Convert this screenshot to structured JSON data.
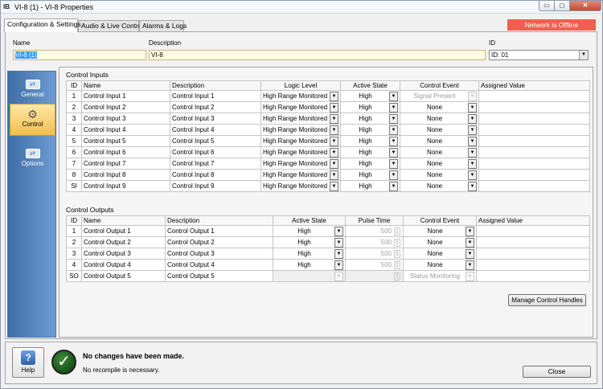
{
  "window": {
    "app_icon_text": "IB",
    "title": "VI-8 (1) - VI-8 Properties",
    "controls": {
      "minimize": "▭",
      "maximize": "◻",
      "close": "✕"
    }
  },
  "tabs": [
    {
      "label": "Configuration & Settings",
      "active": true
    },
    {
      "label": "Audio & Live Control",
      "active": false
    },
    {
      "label": "Alarms & Logs",
      "active": false
    }
  ],
  "status_badge": {
    "label": "Network is Offline",
    "color": "#f06050"
  },
  "header": {
    "name_label": "Name",
    "name_value": "VI-8 (1)",
    "description_label": "Description",
    "description_value": "VI-8",
    "id_label": "ID",
    "id_value": "ID: 01"
  },
  "sidebar": {
    "items": [
      {
        "label": "General",
        "icon": "network-icon",
        "active": false
      },
      {
        "label": "Control",
        "icon": "gear-icon",
        "active": true
      },
      {
        "label": "Options",
        "icon": "network-icon",
        "active": false
      }
    ]
  },
  "control_inputs": {
    "title": "Control Inputs",
    "columns": {
      "id": "ID",
      "name": "Name",
      "description": "Description",
      "logic_level": "Logic Level",
      "active_state": "Active State",
      "control_event": "Control Event",
      "assigned_value": "Assigned Value"
    },
    "rows": [
      {
        "id": "1",
        "name": "Control Input 1",
        "description": "Control Input 1",
        "logic_level": "High Range Monitored",
        "active_state": "High",
        "control_event": "Signal Present",
        "assigned_value": ""
      },
      {
        "id": "2",
        "name": "Control Input 2",
        "description": "Control Input 2",
        "logic_level": "High Range Monitored",
        "active_state": "High",
        "control_event": "None",
        "assigned_value": ""
      },
      {
        "id": "3",
        "name": "Control Input 3",
        "description": "Control Input 3",
        "logic_level": "High Range Monitored",
        "active_state": "High",
        "control_event": "None",
        "assigned_value": ""
      },
      {
        "id": "4",
        "name": "Control Input 4",
        "description": "Control Input 4",
        "logic_level": "High Range Monitored",
        "active_state": "High",
        "control_event": "None",
        "assigned_value": ""
      },
      {
        "id": "5",
        "name": "Control Input 5",
        "description": "Control Input 5",
        "logic_level": "High Range Monitored",
        "active_state": "High",
        "control_event": "None",
        "assigned_value": ""
      },
      {
        "id": "6",
        "name": "Control Input 6",
        "description": "Control Input 6",
        "logic_level": "High Range Monitored",
        "active_state": "High",
        "control_event": "None",
        "assigned_value": ""
      },
      {
        "id": "7",
        "name": "Control Input 7",
        "description": "Control Input 7",
        "logic_level": "High Range Monitored",
        "active_state": "High",
        "control_event": "None",
        "assigned_value": ""
      },
      {
        "id": "8",
        "name": "Control Input 8",
        "description": "Control Input 8",
        "logic_level": "High Range Monitored",
        "active_state": "High",
        "control_event": "None",
        "assigned_value": ""
      },
      {
        "id": "SI",
        "name": "Control Input 9",
        "description": "Control Input 9",
        "logic_level": "High Range Monitored",
        "active_state": "High",
        "control_event": "None",
        "assigned_value": ""
      }
    ]
  },
  "control_outputs": {
    "title": "Control Outputs",
    "columns": {
      "id": "ID",
      "name": "Name",
      "description": "Description",
      "active_state": "Active State",
      "pulse_time": "Pulse Time",
      "control_event": "Control Event",
      "assigned_value": "Assigned Value"
    },
    "rows": [
      {
        "id": "1",
        "name": "Control Output 1",
        "description": "Control Output 1",
        "active_state": "High",
        "pulse_time": "500",
        "control_event": "None",
        "assigned_value": ""
      },
      {
        "id": "2",
        "name": "Control Output 2",
        "description": "Control Output 2",
        "active_state": "High",
        "pulse_time": "500",
        "control_event": "None",
        "assigned_value": ""
      },
      {
        "id": "3",
        "name": "Control Output 3",
        "description": "Control Output 3",
        "active_state": "High",
        "pulse_time": "500",
        "control_event": "None",
        "assigned_value": ""
      },
      {
        "id": "4",
        "name": "Control Output 4",
        "description": "Control Output 4",
        "active_state": "High",
        "pulse_time": "500",
        "control_event": "None",
        "assigned_value": ""
      },
      {
        "id": "SO",
        "name": "Control Output 5",
        "description": "Control Output 5",
        "active_state": "",
        "pulse_time": "",
        "control_event": "Status Monitoring",
        "assigned_value": ""
      }
    ]
  },
  "manage_button": "Manage Control Handles",
  "footer": {
    "help_label": "Help",
    "help_icon_glyph": "?",
    "status_icon_glyph": "✓",
    "status_main": "No changes have been made.",
    "status_sub": "No recompile is necessary.",
    "close_label": "Close"
  }
}
